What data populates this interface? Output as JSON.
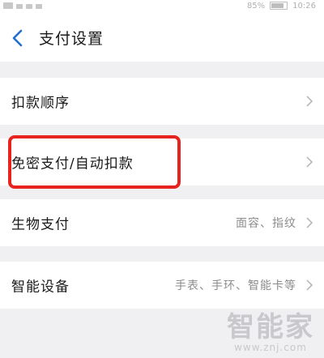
{
  "status_bar": {
    "battery_percent": "85%",
    "time": "10:26"
  },
  "nav": {
    "back_icon": "chevron-left-icon",
    "title": "支付设置"
  },
  "rows": [
    {
      "label": "扣款顺序",
      "value": ""
    },
    {
      "label": "免密支付/自动扣款",
      "value": ""
    },
    {
      "label": "生物支付",
      "value": "面容、指纹"
    },
    {
      "label": "智能设备",
      "value": "手表、手环、智能卡等"
    }
  ],
  "colors": {
    "accent": "#1f6fd0",
    "highlight": "#e8231f"
  },
  "watermark": {
    "main": "智能家",
    "sub": "www.znj.com"
  }
}
